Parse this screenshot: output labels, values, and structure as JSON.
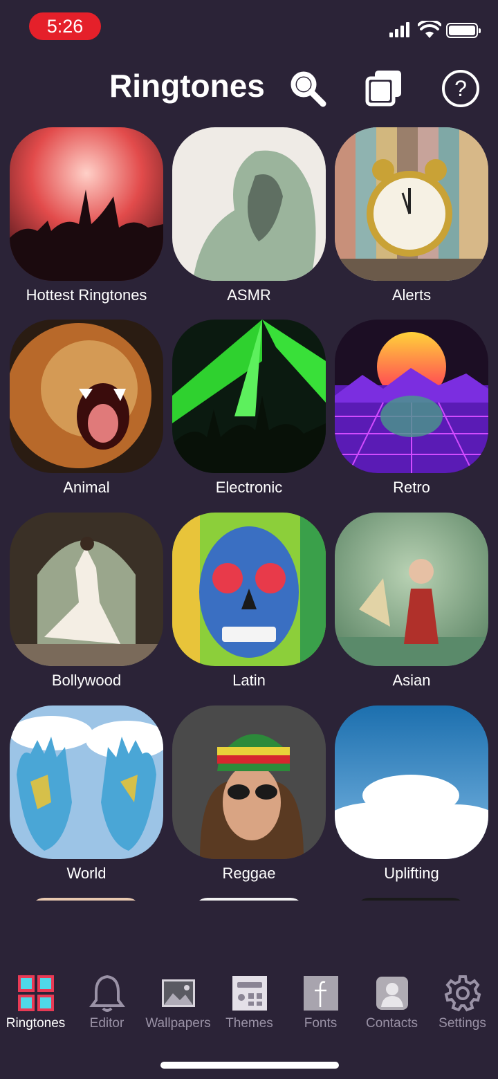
{
  "status_bar": {
    "time": "5:26",
    "accent": "#e5202a"
  },
  "header": {
    "title": "Ringtones",
    "icons": [
      "search-icon",
      "copy-icon",
      "help-icon"
    ]
  },
  "categories": [
    {
      "label": "Hottest Ringtones"
    },
    {
      "label": "ASMR"
    },
    {
      "label": "Alerts"
    },
    {
      "label": "Animal"
    },
    {
      "label": "Electronic"
    },
    {
      "label": "Retro"
    },
    {
      "label": "Bollywood"
    },
    {
      "label": "Latin"
    },
    {
      "label": "Asian"
    },
    {
      "label": "World"
    },
    {
      "label": "Reggae"
    },
    {
      "label": "Uplifting"
    }
  ],
  "tabs": [
    {
      "label": "Ringtones",
      "icon": "grid-icon",
      "active": true
    },
    {
      "label": "Editor",
      "icon": "bell-icon"
    },
    {
      "label": "Wallpapers",
      "icon": "picture-icon"
    },
    {
      "label": "Themes",
      "icon": "theme-icon"
    },
    {
      "label": "Fonts",
      "icon": "font-icon"
    },
    {
      "label": "Contacts",
      "icon": "contact-icon"
    },
    {
      "label": "Settings",
      "icon": "gear-icon"
    }
  ],
  "colors": {
    "background": "#2b2337",
    "tab_inactive": "#9a92a6",
    "tab_active_icon": "#e83a55"
  }
}
